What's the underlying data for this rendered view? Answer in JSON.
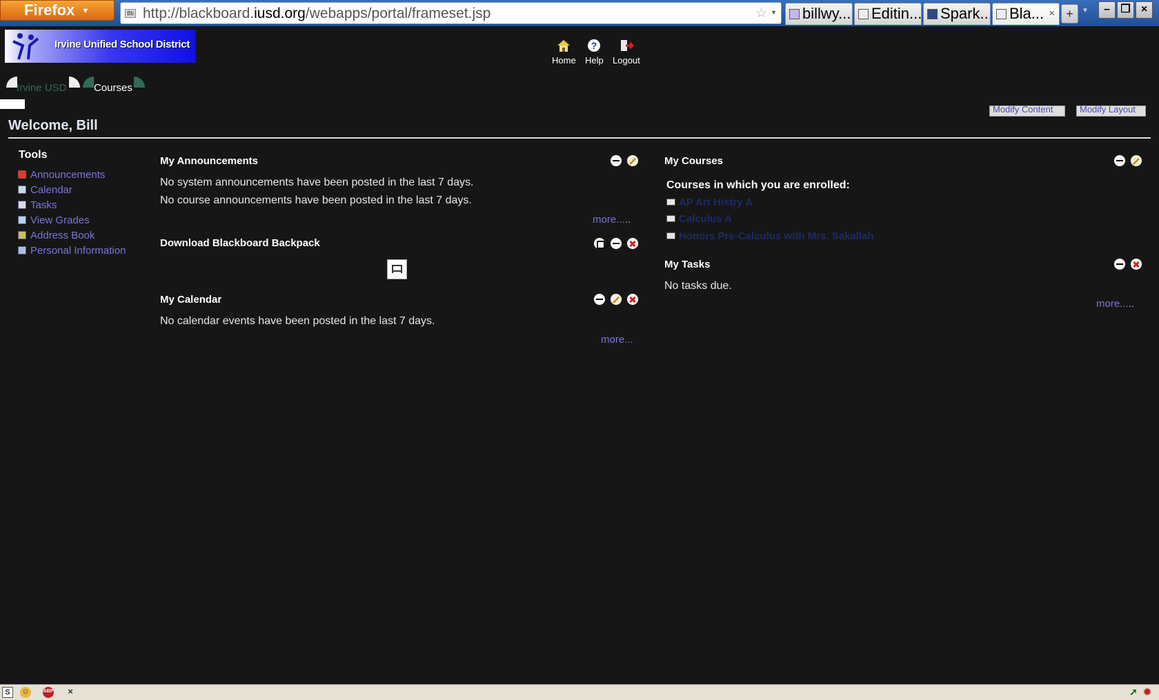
{
  "browser": {
    "app_button_label": "Firefox",
    "url_prefix": "http://blackboard.",
    "url_domain": "iusd.org",
    "url_path": "/webapps/portal/frameset.jsp",
    "tabs": [
      {
        "label": "billwy..."
      },
      {
        "label": "Editin..."
      },
      {
        "label": "Spark..."
      },
      {
        "label": "Bla..."
      }
    ],
    "new_tab_label": "+"
  },
  "header": {
    "logo_text": "Irvine Unified School District",
    "nav": {
      "home": "Home",
      "help": "Help",
      "logout": "Logout"
    },
    "tabs": {
      "institution": "Irvine USD",
      "courses": "Courses"
    },
    "modify_content": "Modify Content",
    "modify_layout": "Modify Layout"
  },
  "welcome": "Welcome, Bill",
  "tools": {
    "title": "Tools",
    "items": [
      {
        "label": "Announcements"
      },
      {
        "label": "Calendar"
      },
      {
        "label": "Tasks"
      },
      {
        "label": "View Grades"
      },
      {
        "label": "Address Book"
      },
      {
        "label": "Personal Information"
      }
    ]
  },
  "modules": {
    "announcements": {
      "title": "My Announcements",
      "line1": "No system announcements have been posted in the last 7 days.",
      "line2": "No course announcements have been posted in the last 7 days.",
      "more": "more...",
      "more_dots": ".."
    },
    "backpack": {
      "title": "Download Blackboard Backpack"
    },
    "calendar": {
      "title": "My Calendar",
      "line1": "No calendar events have been posted in the last 7 days.",
      "more": "more..."
    },
    "courses": {
      "title": "My Courses",
      "subtitle": "Courses in which you are enrolled:",
      "items": [
        {
          "label": "AP Art Histry A"
        },
        {
          "label": "Calculus A"
        },
        {
          "label": "Honors Pre-Calculus with Mrs. Sakallah"
        }
      ]
    },
    "tasks": {
      "title": "My Tasks",
      "line1": "No tasks due.",
      "more": "more...",
      "more_dots": ".."
    }
  },
  "colors": {
    "background": "#161616",
    "link": "#7b75d8",
    "course_link": "#1d2a66",
    "tab_green": "#2f6a58"
  }
}
